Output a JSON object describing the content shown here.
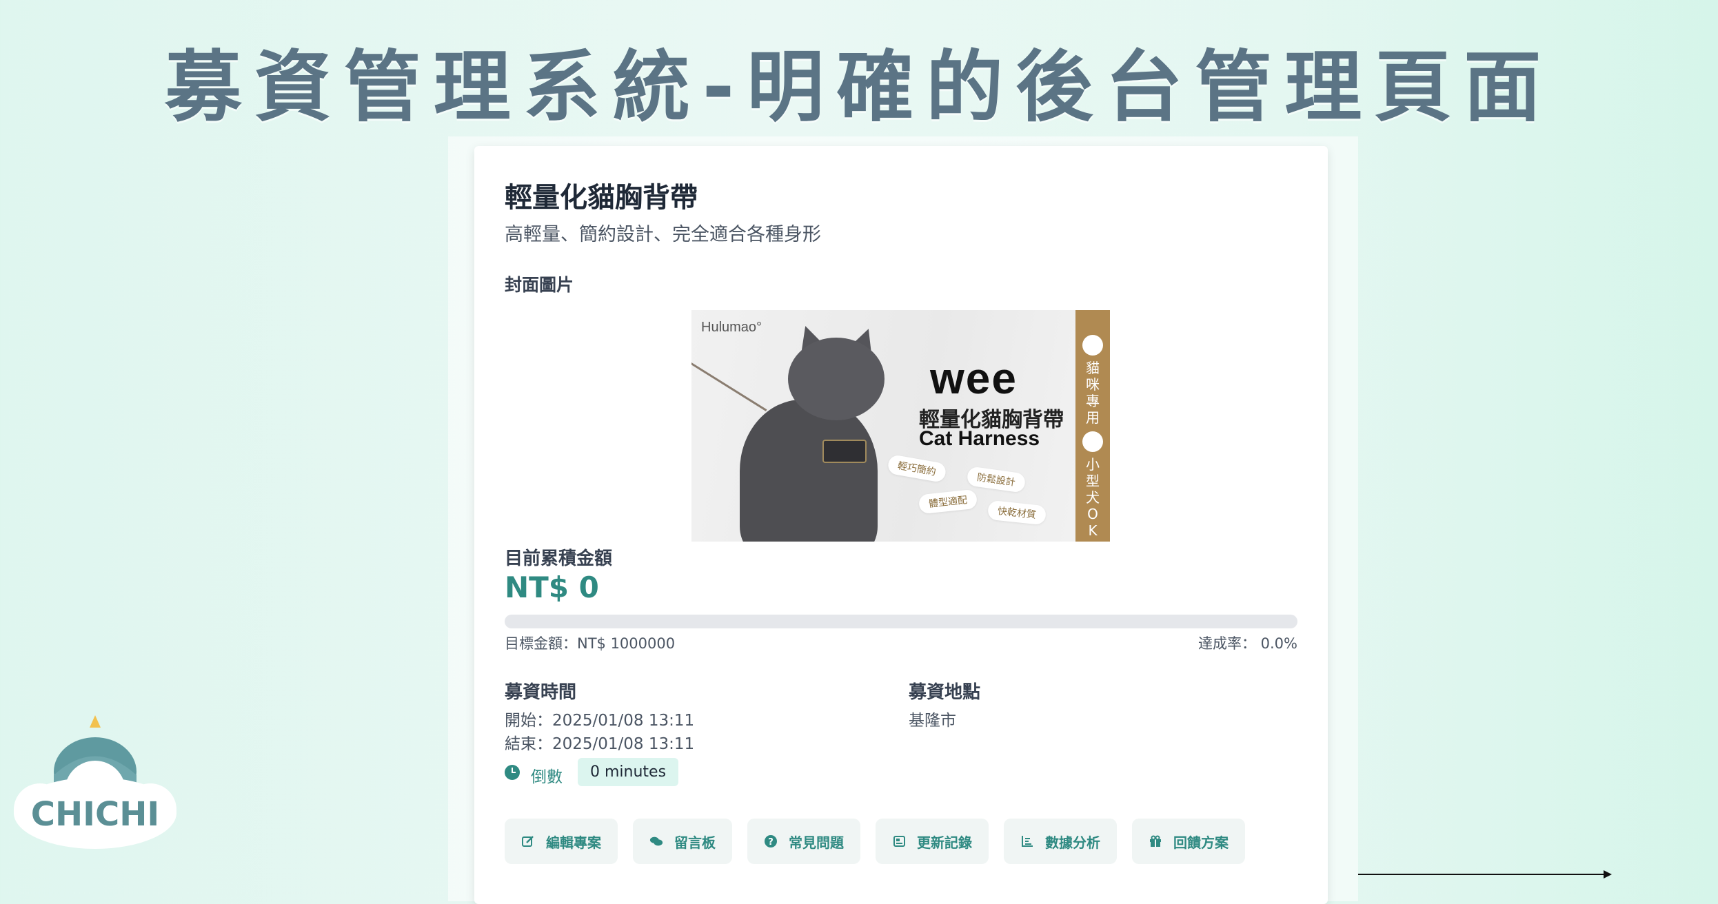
{
  "slide": {
    "title": "募資管理系統-明確的後台管理頁面"
  },
  "project": {
    "title": "輕量化貓胸背帶",
    "subtitle": "高輕量、簡約設計、完全適合各種身形",
    "cover_label": "封面圖片",
    "cover_image": {
      "brand": "Hulumao°",
      "headline": "wee",
      "title_zh": "輕量化貓胸背帶",
      "title_en": "Cat Harness",
      "tags": [
        "輕巧簡約",
        "防鬆設計",
        "體型適配",
        "快乾材質"
      ],
      "band_top": "貓咪專用",
      "band_bottom": "小型犬OK",
      "band_color": "#b08a52"
    }
  },
  "funding": {
    "amount_label": "目前累積金額",
    "amount": "NT$ 0",
    "progress_fraction": 0.0,
    "goal_text": "目標金額：NT$ 1000000",
    "rate_text": "達成率： 0.0%",
    "accent_color": "#2f8a82"
  },
  "time": {
    "heading": "募資時間",
    "start": "開始：2025/01/08 13:11",
    "end": "結束：2025/01/08 13:11",
    "countdown_label": "倒數",
    "countdown_value": "0 minutes"
  },
  "location": {
    "heading": "募資地點",
    "value": "基隆市"
  },
  "actions": [
    {
      "label": "編輯專案",
      "icon": "edit-icon"
    },
    {
      "label": "留言板",
      "icon": "comments-icon"
    },
    {
      "label": "常見問題",
      "icon": "question-icon"
    },
    {
      "label": "更新記錄",
      "icon": "newspaper-icon"
    },
    {
      "label": "數據分析",
      "icon": "chart-icon"
    },
    {
      "label": "回饋方案",
      "icon": "gift-icon"
    }
  ],
  "mascot": {
    "text": "CHICHI"
  }
}
